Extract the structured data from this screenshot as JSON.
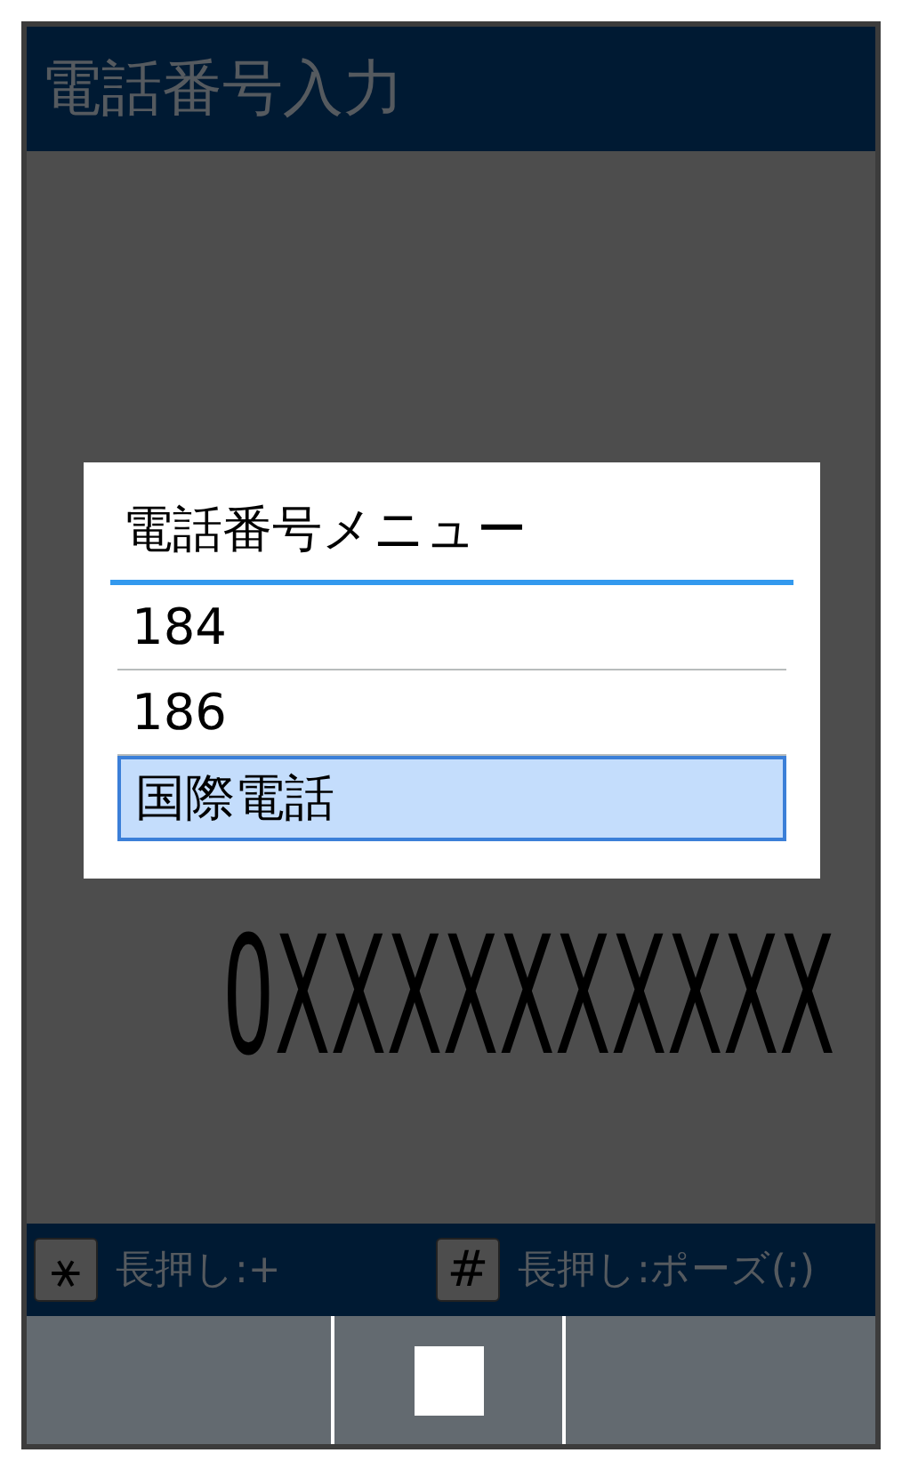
{
  "header": {
    "title": "電話番号入力"
  },
  "dialog": {
    "title": "電話番号メニュー",
    "items": [
      {
        "label": "184",
        "selected": false
      },
      {
        "label": "186",
        "selected": false
      },
      {
        "label": "国際電話",
        "selected": true
      }
    ]
  },
  "number": "0XXXXXXXXXX",
  "hints": [
    {
      "key": "⚹",
      "label": "長押し:+"
    },
    {
      "key": "#",
      "label": "長押し:ポーズ(;)"
    }
  ]
}
